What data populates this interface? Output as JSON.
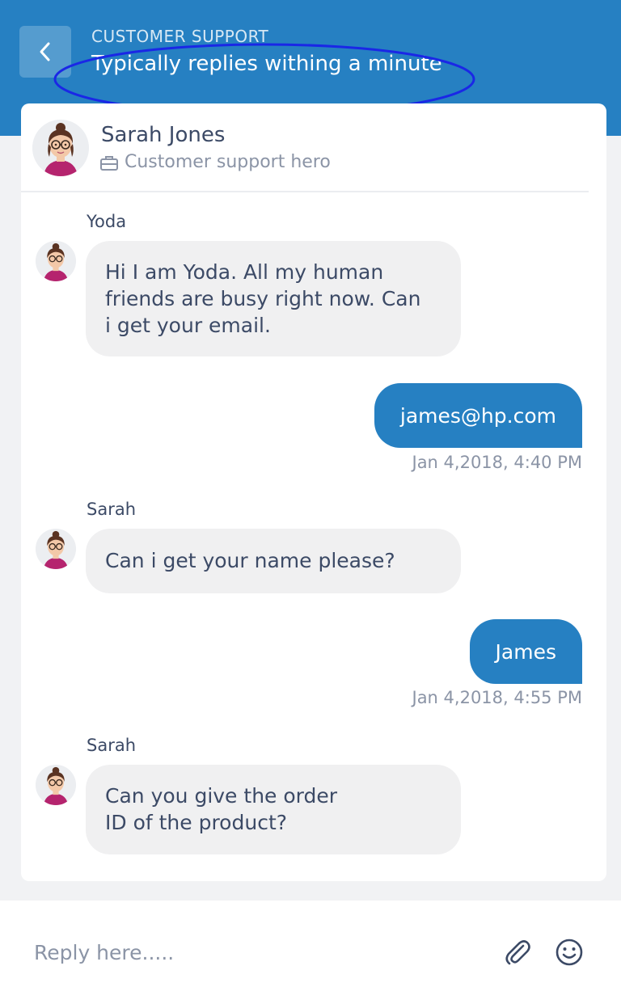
{
  "header": {
    "label": "CUSTOMER SUPPORT",
    "subtitle": "Typically replies withing a minute",
    "back_icon": "chevron-left-icon",
    "highlight_color": "#1a27e6"
  },
  "agent": {
    "name": "Sarah Jones",
    "role": "Customer support hero",
    "role_icon": "briefcase-icon"
  },
  "messages": [
    {
      "direction": "incoming",
      "sender": "Yoda",
      "text_lines": [
        "Hi I am Yoda. All my human",
        "friends are busy right now. Can",
        "i get your email."
      ]
    },
    {
      "direction": "outgoing",
      "text": "james@hp.com",
      "timestamp": "Jan 4,2018, 4:40 PM"
    },
    {
      "direction": "incoming",
      "sender": "Sarah",
      "text_lines": [
        "Can i get your name please?"
      ]
    },
    {
      "direction": "outgoing",
      "text": "James",
      "timestamp": "Jan 4,2018, 4:55 PM"
    },
    {
      "direction": "incoming",
      "sender": "Sarah",
      "text_lines": [
        "Can you give the order",
        "ID of the product?"
      ]
    }
  ],
  "reply": {
    "placeholder": "Reply here.....",
    "value": "",
    "attach_icon": "paperclip-icon",
    "emoji_icon": "smiley-icon"
  },
  "colors": {
    "accent": "#2680c2",
    "incoming_bubble": "#f0f0f1",
    "background": "#f1f2f4"
  }
}
